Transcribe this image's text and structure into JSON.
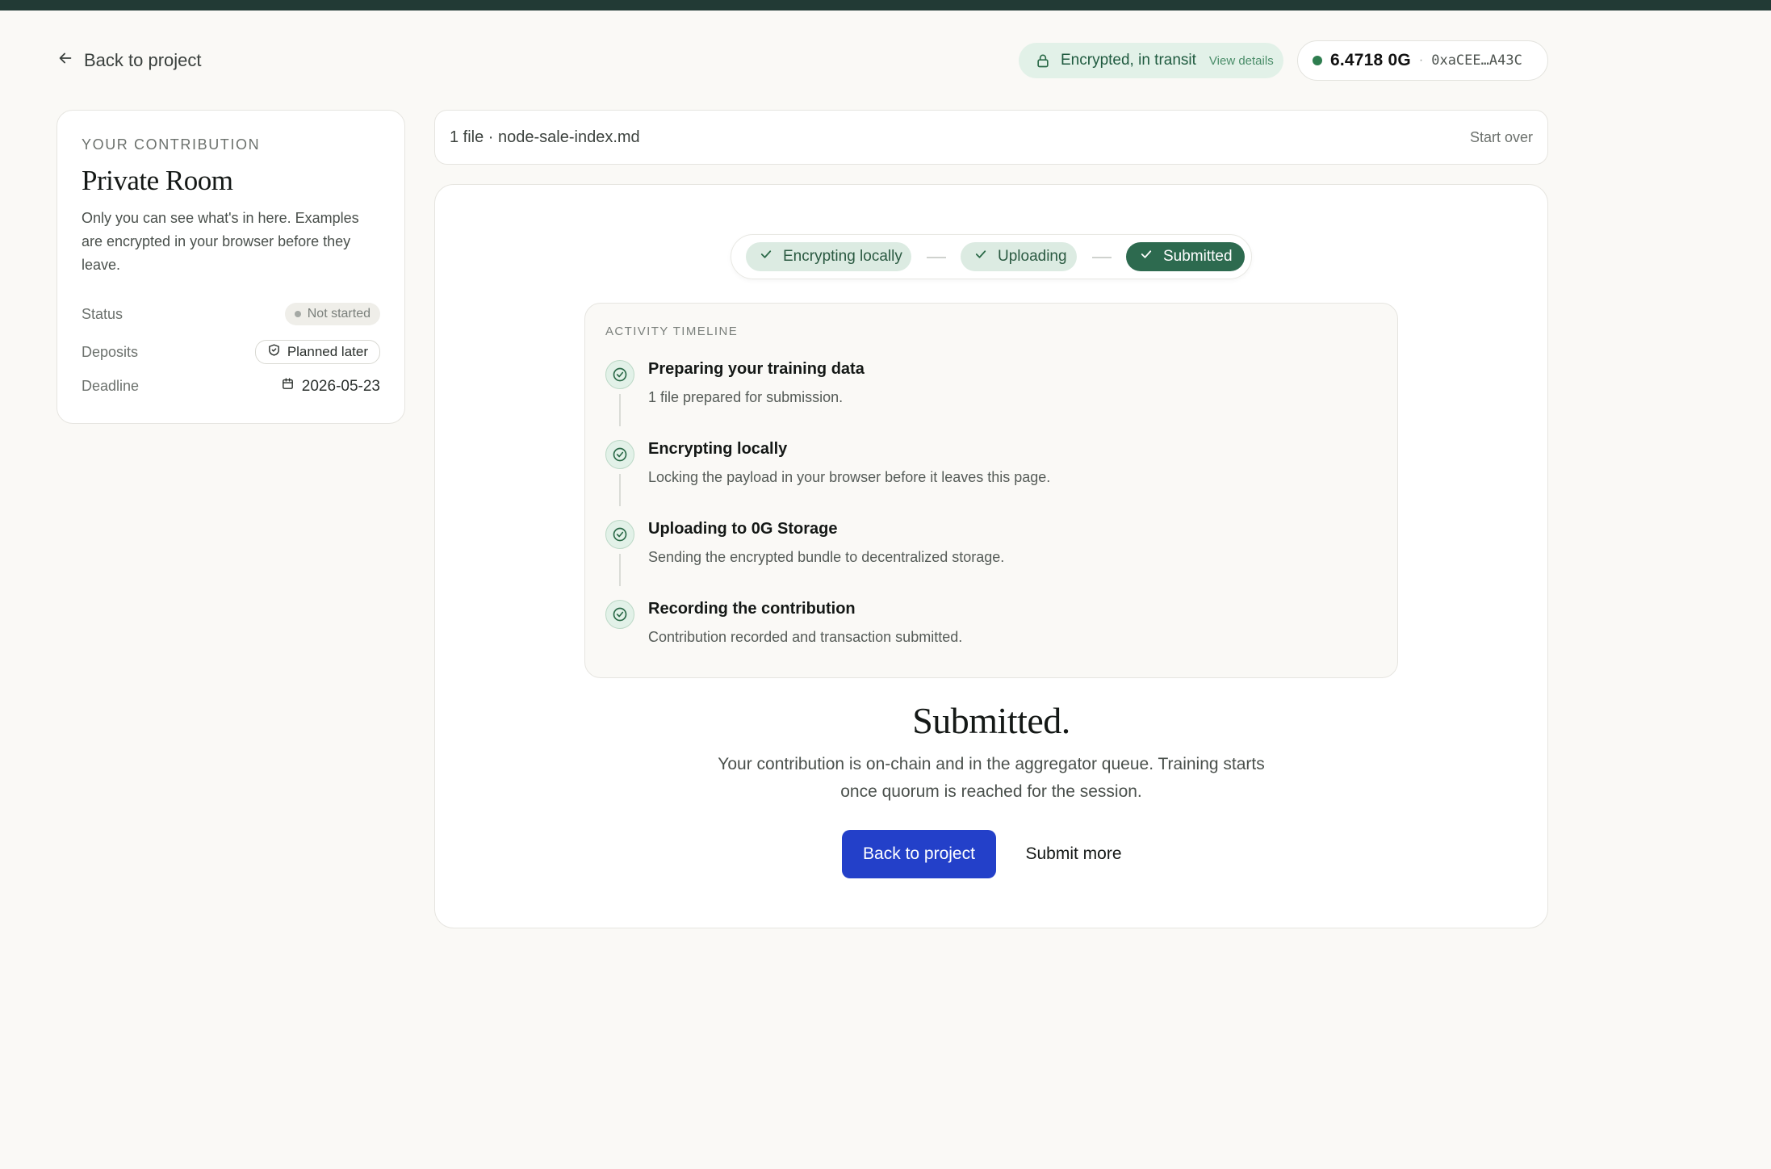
{
  "header": {
    "back_label": "Back to project",
    "encryption_status": "Encrypted, in transit",
    "view_details_label": "View details",
    "wallet_balance": "6.4718 0G",
    "wallet_separator": "·",
    "wallet_address": "0xaCEE…A43C"
  },
  "contribution": {
    "eyebrow": "YOUR CONTRIBUTION",
    "title": "Private Room",
    "description": "Only you can see what's in here. Examples are encrypted in your browser before they leave.",
    "status_label": "Status",
    "status_value": "Not started",
    "deposits_label": "Deposits",
    "deposits_value": "Planned later",
    "deadline_label": "Deadline",
    "deadline_value": "2026-05-23"
  },
  "file_bar": {
    "file_summary": "1 file · node-sale-index.md",
    "start_over_label": "Start over"
  },
  "stepper": {
    "steps": [
      {
        "label": "Encrypting locally",
        "state": "done"
      },
      {
        "label": "Uploading",
        "state": "done"
      },
      {
        "label": "Submitted",
        "state": "current"
      }
    ]
  },
  "timeline": {
    "title": "ACTIVITY TIMELINE",
    "items": [
      {
        "title": "Preparing your training data",
        "description": "1 file prepared for submission."
      },
      {
        "title": "Encrypting locally",
        "description": "Locking the payload in your browser before it leaves this page."
      },
      {
        "title": "Uploading to 0G Storage",
        "description": "Sending the encrypted bundle to decentralized storage."
      },
      {
        "title": "Recording the contribution",
        "description": "Contribution recorded and transaction submitted."
      }
    ]
  },
  "result": {
    "heading": "Submitted.",
    "message": "Your contribution is on-chain and in the aggregator queue. Training starts once quorum is reached for the session.",
    "primary_button": "Back to project",
    "secondary_button": "Submit more"
  },
  "colors": {
    "accent_green": "#2d6a4f",
    "primary_blue": "#2340c9",
    "topbar": "#223a35",
    "success_light": "#e2f1e8"
  },
  "icons": {
    "back": "arrow-left-icon",
    "lock": "lock-icon",
    "status_dot": "dot-icon",
    "deposit": "shield-check-icon",
    "deadline": "calendar-icon",
    "step_check": "check-icon",
    "timeline_check": "check-circle-icon"
  }
}
